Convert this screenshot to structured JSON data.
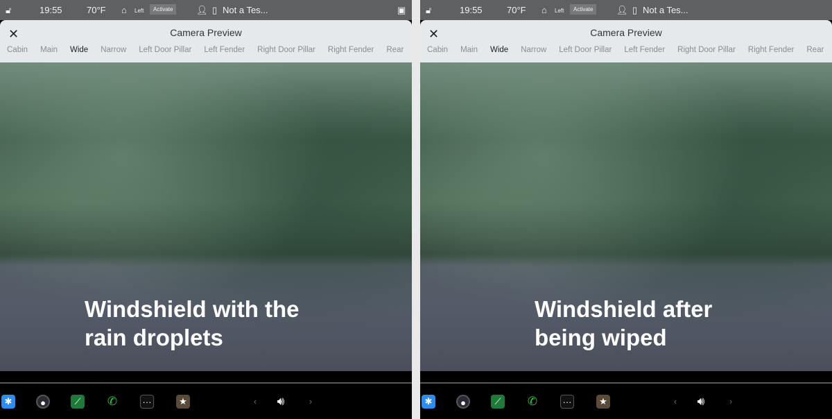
{
  "panels": [
    {
      "status": {
        "time": "19:55",
        "temp": "70°F",
        "home_label": "Left",
        "activate": "Activate",
        "profile": "Not a Tes..."
      },
      "sheet": {
        "title": "Camera Preview",
        "tabs": [
          "Cabin",
          "Main",
          "Wide",
          "Narrow",
          "Left Door Pillar",
          "Left Fender",
          "Right Door Pillar",
          "Right Fender",
          "Rear"
        ],
        "active_tab": "Wide"
      },
      "caption": [
        "Windshield with the",
        "rain droplets"
      ]
    },
    {
      "status": {
        "time": "19:55",
        "temp": "70°F",
        "home_label": "Left",
        "activate": "Activate",
        "profile": "Not a Tes..."
      },
      "sheet": {
        "title": "Camera Preview",
        "tabs": [
          "Cabin",
          "Main",
          "Wide",
          "Narrow",
          "Left Door Pillar",
          "Left Fender",
          "Right Door Pillar",
          "Right Fender",
          "Rear"
        ],
        "active_tab": "Wide"
      },
      "caption": [
        "Windshield after",
        "being wiped"
      ]
    }
  ],
  "dock_icons": [
    "bluetooth-icon",
    "camera-icon",
    "energy-chart-icon",
    "phone-icon",
    "more-icon",
    "toybox-icon"
  ],
  "colors": {
    "status_bar": "#5f6061",
    "sheet": "#e6e9ec",
    "bluetooth": "#2d8cf0",
    "phone": "#2ecc40"
  }
}
